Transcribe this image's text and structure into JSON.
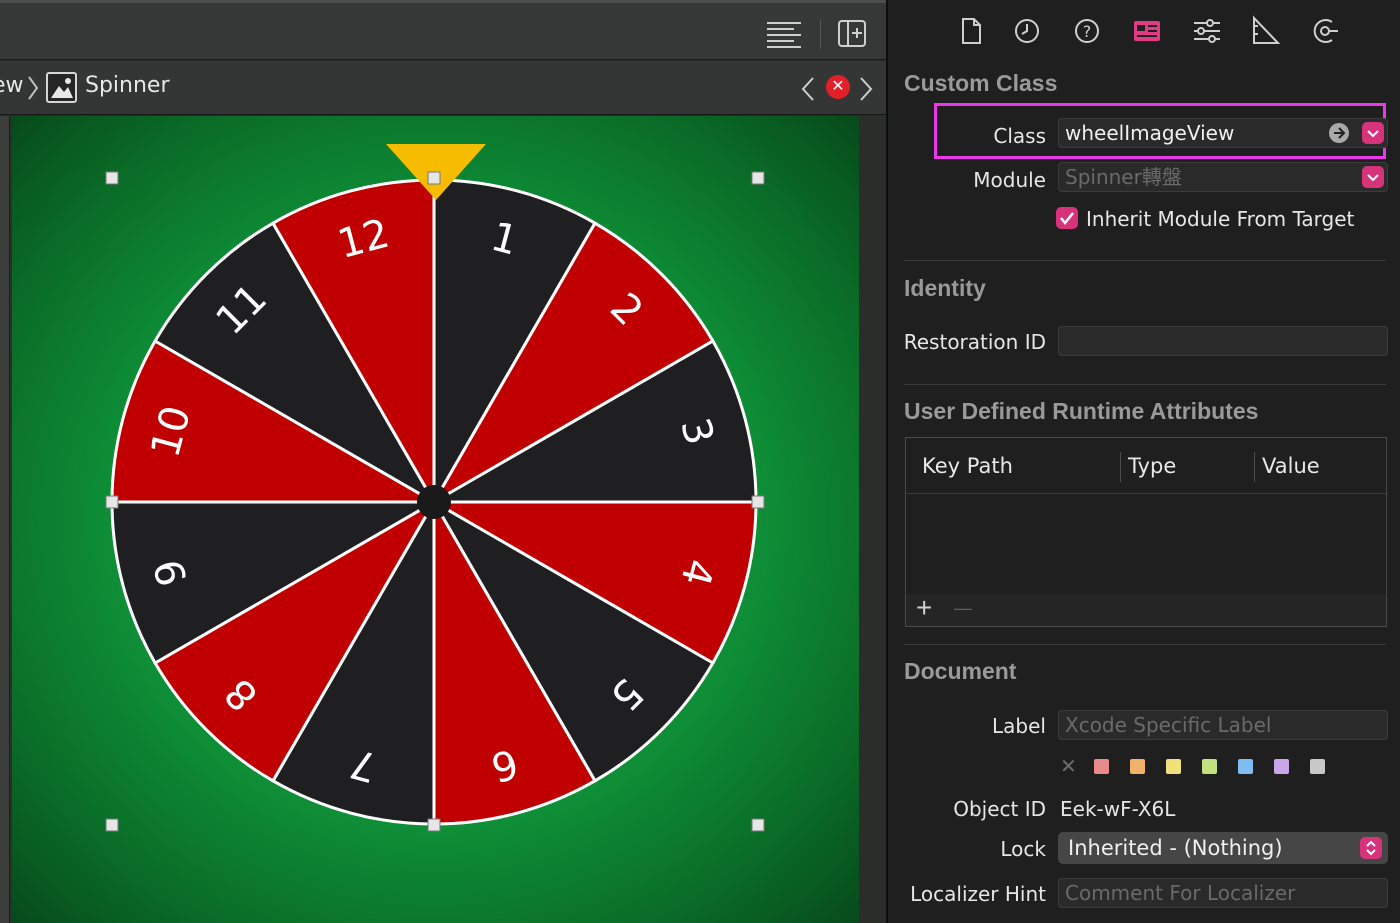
{
  "jumpbar": {
    "prev_crumb": "ew",
    "current_crumb": "Spinner"
  },
  "error_badge": "✕",
  "wheel": {
    "numbers": [
      "1",
      "2",
      "3",
      "4",
      "5",
      "6",
      "7",
      "8",
      "9",
      "10",
      "11",
      "12"
    ],
    "segment_colors": [
      "#1f1f21",
      "#c00000"
    ]
  },
  "inspector": {
    "custom_class": {
      "title": "Custom Class",
      "class_label": "Class",
      "class_value": "wheelImageView",
      "module_label": "Module",
      "module_placeholder": "Spinner轉盤",
      "inherit_label": "Inherit Module From Target"
    },
    "identity": {
      "title": "Identity",
      "restoration_label": "Restoration ID"
    },
    "udra": {
      "title": "User Defined Runtime Attributes",
      "columns": [
        "Key Path",
        "Type",
        "Value"
      ],
      "add": "+",
      "remove": "—"
    },
    "document": {
      "title": "Document",
      "label_label": "Label",
      "label_placeholder": "Xcode Specific Label",
      "clear_glyph": "✕",
      "swatches": [
        "#e88a8a",
        "#f3b26a",
        "#f2e07a",
        "#c3e080",
        "#7fbcf0",
        "#c9a6e8",
        "#c8c8c8"
      ],
      "object_id_label": "Object ID",
      "object_id_value": "Eek-wF-X6L",
      "lock_label": "Lock",
      "lock_value": "Inherited - (Nothing)",
      "localizer_label": "Localizer Hint",
      "localizer_placeholder": "Comment For Localizer"
    }
  }
}
